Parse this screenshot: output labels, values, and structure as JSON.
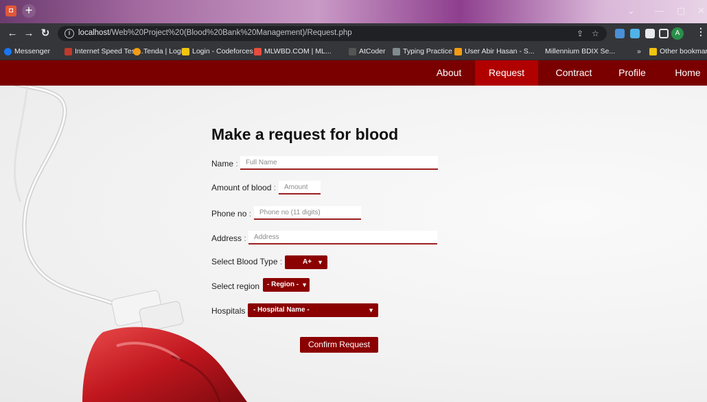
{
  "browser": {
    "url_host": "localhost",
    "url_path": "/Web%20Project%20(Blood%20Bank%20Management)/Request.php",
    "bookmarks": [
      {
        "label": "Messenger",
        "color": "#1877f2"
      },
      {
        "label": "Internet Speed Test...",
        "color": "#c0392b"
      },
      {
        "label": "Tenda | Login",
        "color": "#f39c12"
      },
      {
        "label": "Login - Codeforces",
        "color": "#f1c40f"
      },
      {
        "label": "MLWBD.COM | ML...",
        "color": "#e74c3c"
      },
      {
        "label": "AtCoder",
        "color": "#555555"
      },
      {
        "label": "Typing Practice",
        "color": "#7f8c8d"
      },
      {
        "label": "User Abir Hasan - S...",
        "color": "#f39c12"
      },
      {
        "label": "Millennium BDIX Se...",
        "color": "#3d3d3d"
      }
    ],
    "more_bookmarks": "»",
    "other_bookmarks": "Other bookmarks"
  },
  "nav": {
    "items": [
      {
        "label": "About",
        "active": false
      },
      {
        "label": "Request",
        "active": true
      },
      {
        "label": "Contract",
        "active": false
      },
      {
        "label": "Profile",
        "active": false
      },
      {
        "label": "Home",
        "active": false
      }
    ],
    "bg_color": "#7a0000",
    "active_color": "#b00000"
  },
  "form": {
    "title": "Make a request for blood",
    "name_label": "Name",
    "name_placeholder": "Full Name",
    "amount_label": "Amount of blood",
    "amount_placeholder": "Amount",
    "phone_label": "Phone no",
    "phone_placeholder": "Phone no (11 digits)",
    "address_label": "Address",
    "address_placeholder": "Address",
    "blood_type_label": "Select Blood Type",
    "blood_type_value": "A+",
    "region_label": "Select region",
    "region_value": "- Region -",
    "hospitals_label": "Hospitals",
    "hospital_value": "- Hospital Name -",
    "confirm_label": "Confirm Request",
    "colon": ":"
  }
}
